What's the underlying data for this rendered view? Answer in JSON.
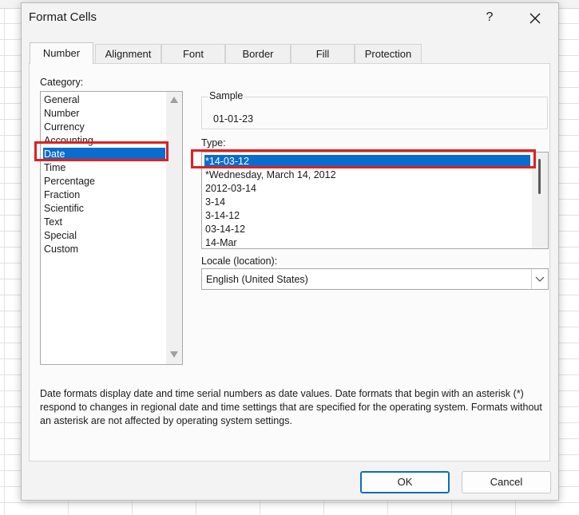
{
  "dialog": {
    "title": "Format Cells",
    "help_label": "?",
    "close_icon": "close-icon"
  },
  "tabs": [
    {
      "label": "Number",
      "active": true
    },
    {
      "label": "Alignment",
      "active": false
    },
    {
      "label": "Font",
      "active": false
    },
    {
      "label": "Border",
      "active": false
    },
    {
      "label": "Fill",
      "active": false
    },
    {
      "label": "Protection",
      "active": false
    }
  ],
  "category": {
    "label": "Category:",
    "items": [
      "General",
      "Number",
      "Currency",
      "Accounting",
      "Date",
      "Time",
      "Percentage",
      "Fraction",
      "Scientific",
      "Text",
      "Special",
      "Custom"
    ],
    "selected": "Date"
  },
  "sample": {
    "label": "Sample",
    "value": "01-01-23"
  },
  "type": {
    "label": "Type:",
    "items": [
      "*14-03-12",
      "*Wednesday, March 14, 2012",
      "2012-03-14",
      "3-14",
      "3-14-12",
      "03-14-12",
      "14-Mar"
    ],
    "selected": "*14-03-12"
  },
  "locale": {
    "label": "Locale (location):",
    "value": "English (United States)"
  },
  "description": "Date formats display date and time serial numbers as date values.  Date formats that begin with an asterisk (*) respond to changes in regional date and time settings that are specified for the operating system. Formats without an asterisk are not affected by operating system settings.",
  "buttons": {
    "ok": "OK",
    "cancel": "Cancel"
  },
  "colors": {
    "selection": "#0a6cce",
    "highlight_box": "#e0201f",
    "default_button_border": "#0f6cbd"
  }
}
